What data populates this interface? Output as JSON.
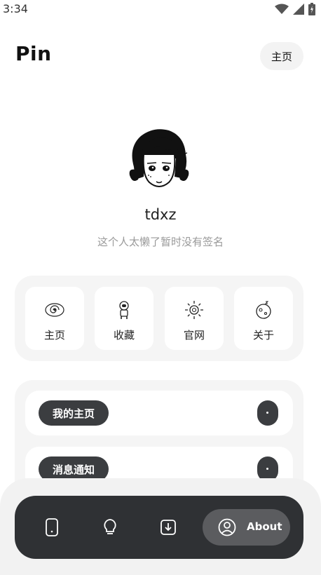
{
  "status_bar": {
    "time": "3:34",
    "icons": [
      "wifi-icon",
      "signal-icon",
      "battery-charging-icon"
    ]
  },
  "header": {
    "title": "Pin",
    "home_button": "主页"
  },
  "profile": {
    "avatar": "avatar-illustration",
    "username": "tdxz",
    "signature": "这个人太懒了暂时没有签名"
  },
  "quick_links": [
    {
      "label": "主页",
      "icon": "galaxy-icon"
    },
    {
      "label": "收藏",
      "icon": "astronaut-icon"
    },
    {
      "label": "官网",
      "icon": "sun-icon"
    },
    {
      "label": "关于",
      "icon": "planet-icon"
    }
  ],
  "menu_rows": [
    {
      "label": "我的主页"
    },
    {
      "label": "消息通知"
    }
  ],
  "bottom_nav": {
    "items": [
      {
        "icon": "phone-icon"
      },
      {
        "icon": "lightbulb-icon"
      },
      {
        "icon": "download-icon"
      }
    ],
    "active": {
      "icon": "user-circle-icon",
      "label": "About"
    }
  },
  "colors": {
    "nav_background": "#2f3134",
    "nav_active": "#5b5c5f",
    "pill": "#3b3d40",
    "panel": "#f5f5f5"
  }
}
